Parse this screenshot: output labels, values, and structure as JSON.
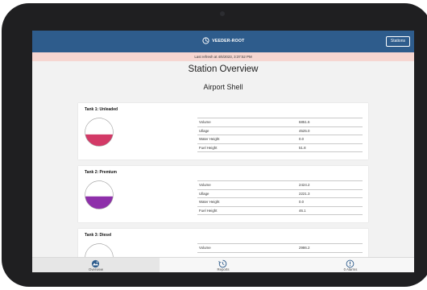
{
  "app": {
    "brand": "VEEDER-ROOT",
    "stations_label": "Stations",
    "last_refresh": "Last refresh at 4/6/2023, 3:37:52 PM"
  },
  "page": {
    "title": "Station Overview",
    "station_name": "Airport Shell"
  },
  "tanks": [
    {
      "name": "Tank 1: Unleaded",
      "fill_fraction": 0.42,
      "fill_color": "#d33a67",
      "metrics": [
        {
          "label": "Volume",
          "value": "6851.6"
        },
        {
          "label": "Ullage",
          "value": "4525.0"
        },
        {
          "label": "Water Height",
          "value": "0.0"
        },
        {
          "label": "Fuel Height",
          "value": "51.8"
        }
      ]
    },
    {
      "name": "Tank 2: Premium",
      "fill_fraction": 0.45,
      "fill_color": "#8e2faa",
      "metrics": [
        {
          "label": "Volume",
          "value": "2424.2"
        },
        {
          "label": "Ullage",
          "value": "2221.3"
        },
        {
          "label": "Water Height",
          "value": "0.0"
        },
        {
          "label": "Fuel Height",
          "value": "46.1"
        }
      ]
    },
    {
      "name": "Tank 3: Diesel",
      "metrics": [
        {
          "label": "Volume",
          "value": "2986.2"
        }
      ]
    }
  ],
  "tabbar": {
    "overview": {
      "label": "Overview",
      "icon": "overview-icon"
    },
    "reports": {
      "label": "Reports",
      "icon": "reports-icon"
    },
    "alarms": {
      "label": "0 Alarms",
      "icon": "alarm-icon"
    }
  },
  "colors": {
    "navbar": "#2e5c8c",
    "refresh_banner": "#f6d6d1",
    "unleaded": "#d33a67",
    "premium": "#8e2faa"
  }
}
